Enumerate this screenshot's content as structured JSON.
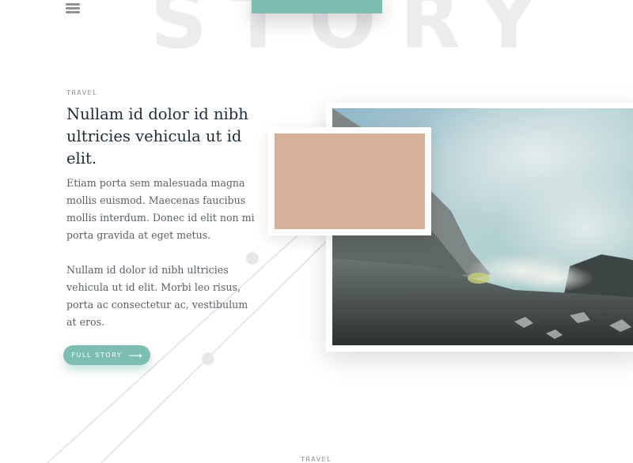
{
  "nav": {
    "menu_icon": "hamburger-icon"
  },
  "hero": {
    "background_word": "STORY"
  },
  "article": {
    "category": "TRAVEL",
    "title": "Nullam id dolor id nibh ultricies vehicula ut id elit.",
    "paragraphs": [
      "Etiam porta sem malesuada magna mollis euismod. Maecenas faucibus mollis interdum. Donec id elit non mi porta gravida at eget metus.",
      "Nullam id dolor id nibh ultricies vehicula ut id elit. Morbi leo risus, porta ac consectetur ac, vestibulum at eros."
    ],
    "cta_label": "FULL STORY",
    "cta_icon": "arrow-right-icon"
  },
  "next_article": {
    "category": "TRAVEL"
  },
  "colors": {
    "accent": "#7dbdb2",
    "heading": "#1e2c3a",
    "body_text": "#5a6068",
    "thumbnail": "#d7b09a",
    "background_word": "#ececee"
  }
}
